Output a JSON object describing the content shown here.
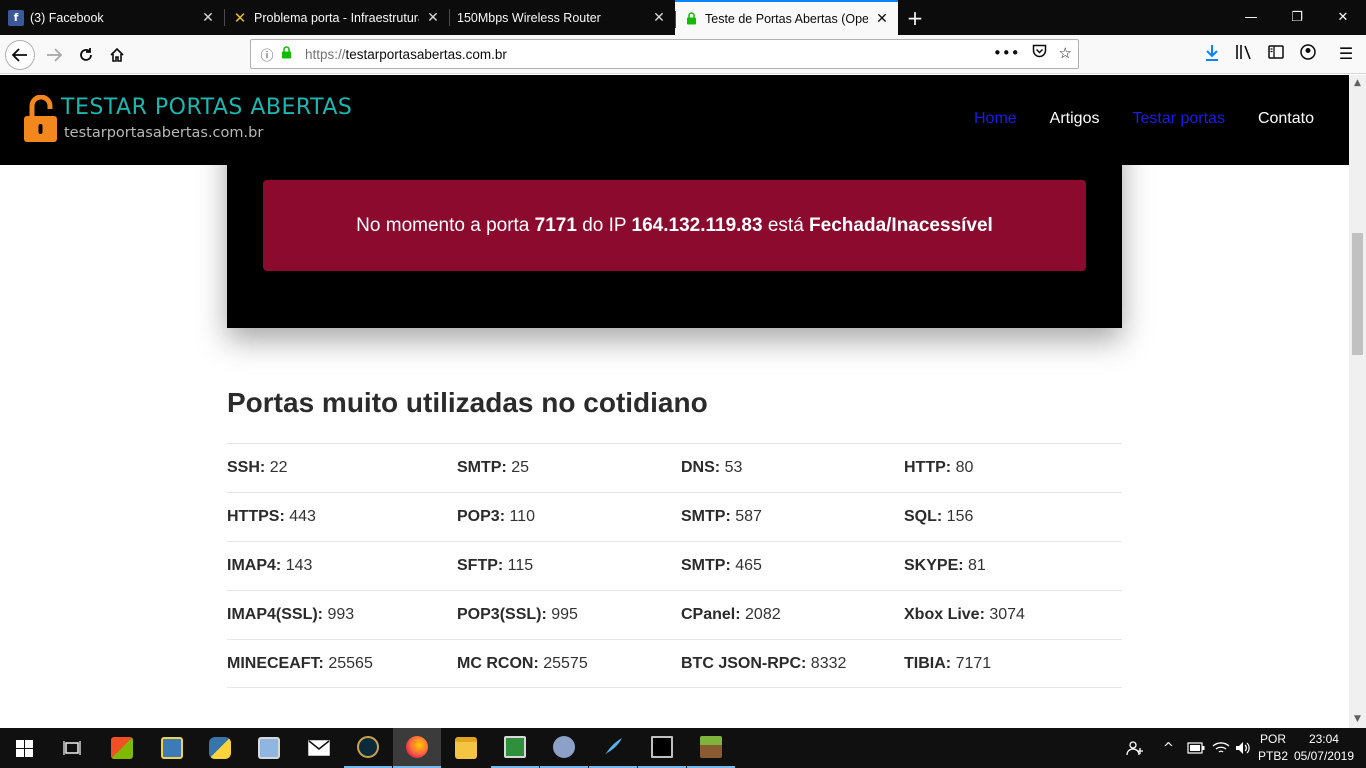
{
  "browser": {
    "tabs": [
      {
        "label": "(3) Facebook",
        "icon": "facebook-icon",
        "active": false
      },
      {
        "label": "Problema porta - Infraestrutura",
        "icon": "x-logo-icon",
        "active": false
      },
      {
        "label": "150Mbps Wireless Router",
        "icon": "none",
        "active": false
      },
      {
        "label": "Teste de Portas Abertas (Open",
        "icon": "lock-icon",
        "active": true
      }
    ],
    "url_protocol": "https://",
    "url_host": "testarportasabertas.com.br",
    "accent_color": "#0a84ff"
  },
  "site": {
    "brand_title": "TESTAR PORTAS ABERTAS",
    "brand_subtitle": "testarportasabertas.com.br",
    "brand_color": "#1bb7b0",
    "nav": [
      {
        "label": "Home",
        "color": "blue"
      },
      {
        "label": "Artigos",
        "color": "white"
      },
      {
        "label": "Testar portas",
        "color": "blue"
      },
      {
        "label": "Contato",
        "color": "white"
      }
    ]
  },
  "result": {
    "prefix": "No momento a porta",
    "port": "7171",
    "mid": "do IP",
    "ip": "164.132.119.83",
    "verb": "está",
    "status": "Fechada/Inacessível",
    "alert_color": "#8b0a2e"
  },
  "ports_section": {
    "title": "Portas muito utilizadas no cotidiano",
    "rows": [
      [
        {
          "name": "SSH:",
          "port": "22"
        },
        {
          "name": "SMTP:",
          "port": "25"
        },
        {
          "name": "DNS:",
          "port": "53"
        },
        {
          "name": "HTTP:",
          "port": "80"
        }
      ],
      [
        {
          "name": "HTTPS:",
          "port": "443"
        },
        {
          "name": "POP3:",
          "port": "110"
        },
        {
          "name": "SMTP:",
          "port": "587"
        },
        {
          "name": "SQL:",
          "port": "156"
        }
      ],
      [
        {
          "name": "IMAP4:",
          "port": "143"
        },
        {
          "name": "SFTP:",
          "port": "115"
        },
        {
          "name": "SMTP:",
          "port": "465"
        },
        {
          "name": "SKYPE:",
          "port": "81"
        }
      ],
      [
        {
          "name": "IMAP4(SSL):",
          "port": "993"
        },
        {
          "name": "POP3(SSL):",
          "port": "995"
        },
        {
          "name": "CPanel:",
          "port": "2082"
        },
        {
          "name": "Xbox Live:",
          "port": "3074"
        }
      ],
      [
        {
          "name": "MINECEAFT:",
          "port": "25565"
        },
        {
          "name": "MC RCON:",
          "port": "25575"
        },
        {
          "name": "BTC JSON-RPC:",
          "port": "8332"
        },
        {
          "name": "TIBIA:",
          "port": "7171"
        }
      ]
    ]
  },
  "taskbar": {
    "language": "POR",
    "keyboard": "PTB2",
    "time": "23:04",
    "date": "05/07/2019"
  }
}
